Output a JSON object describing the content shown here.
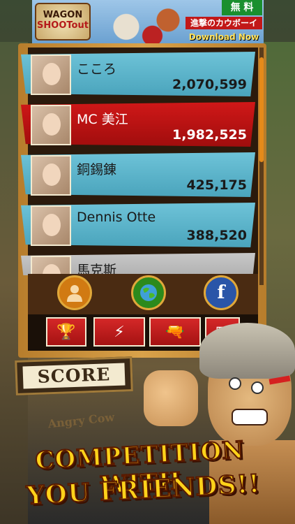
{
  "banner": {
    "logo_line1": "WAGON",
    "logo_line2": "SHOOTout",
    "free_label": "無 料",
    "promo_jp": "進撃のカウボーイ",
    "download_label": "Download Now"
  },
  "leaderboard": [
    {
      "name": "こころ",
      "score": "2,070,599",
      "highlight": false
    },
    {
      "name": "MC 美江",
      "score": "1,982,525",
      "highlight": true
    },
    {
      "name": "銅錫錬",
      "score": "425,175",
      "highlight": false
    },
    {
      "name": "Dennis Otte",
      "score": "388,520",
      "highlight": false
    },
    {
      "name": "馬克斯",
      "score": "",
      "highlight": false
    }
  ],
  "buttons": {
    "profile_icon": "person-icon",
    "world_icon": "globe-icon",
    "facebook_label": "f"
  },
  "tabs": [
    {
      "icon": "trophy-icon",
      "glyph": "🏆"
    },
    {
      "icon": "lightning-icon",
      "glyph": "⚡"
    },
    {
      "icon": "guns-icon",
      "glyph": "🔫"
    },
    {
      "icon": "calendar-icon",
      "glyph": "▦"
    }
  ],
  "score_sign": "SCORE",
  "background_text": "Angry Cow",
  "promo": {
    "line1": "COMPETITION WITH",
    "line2": "YOU FRIENDS!!"
  },
  "colors": {
    "row_blue": "#5ab4cc",
    "row_red": "#c01414",
    "frame_gold": "#d9a24a",
    "promo_yellow": "#ffd21a"
  }
}
